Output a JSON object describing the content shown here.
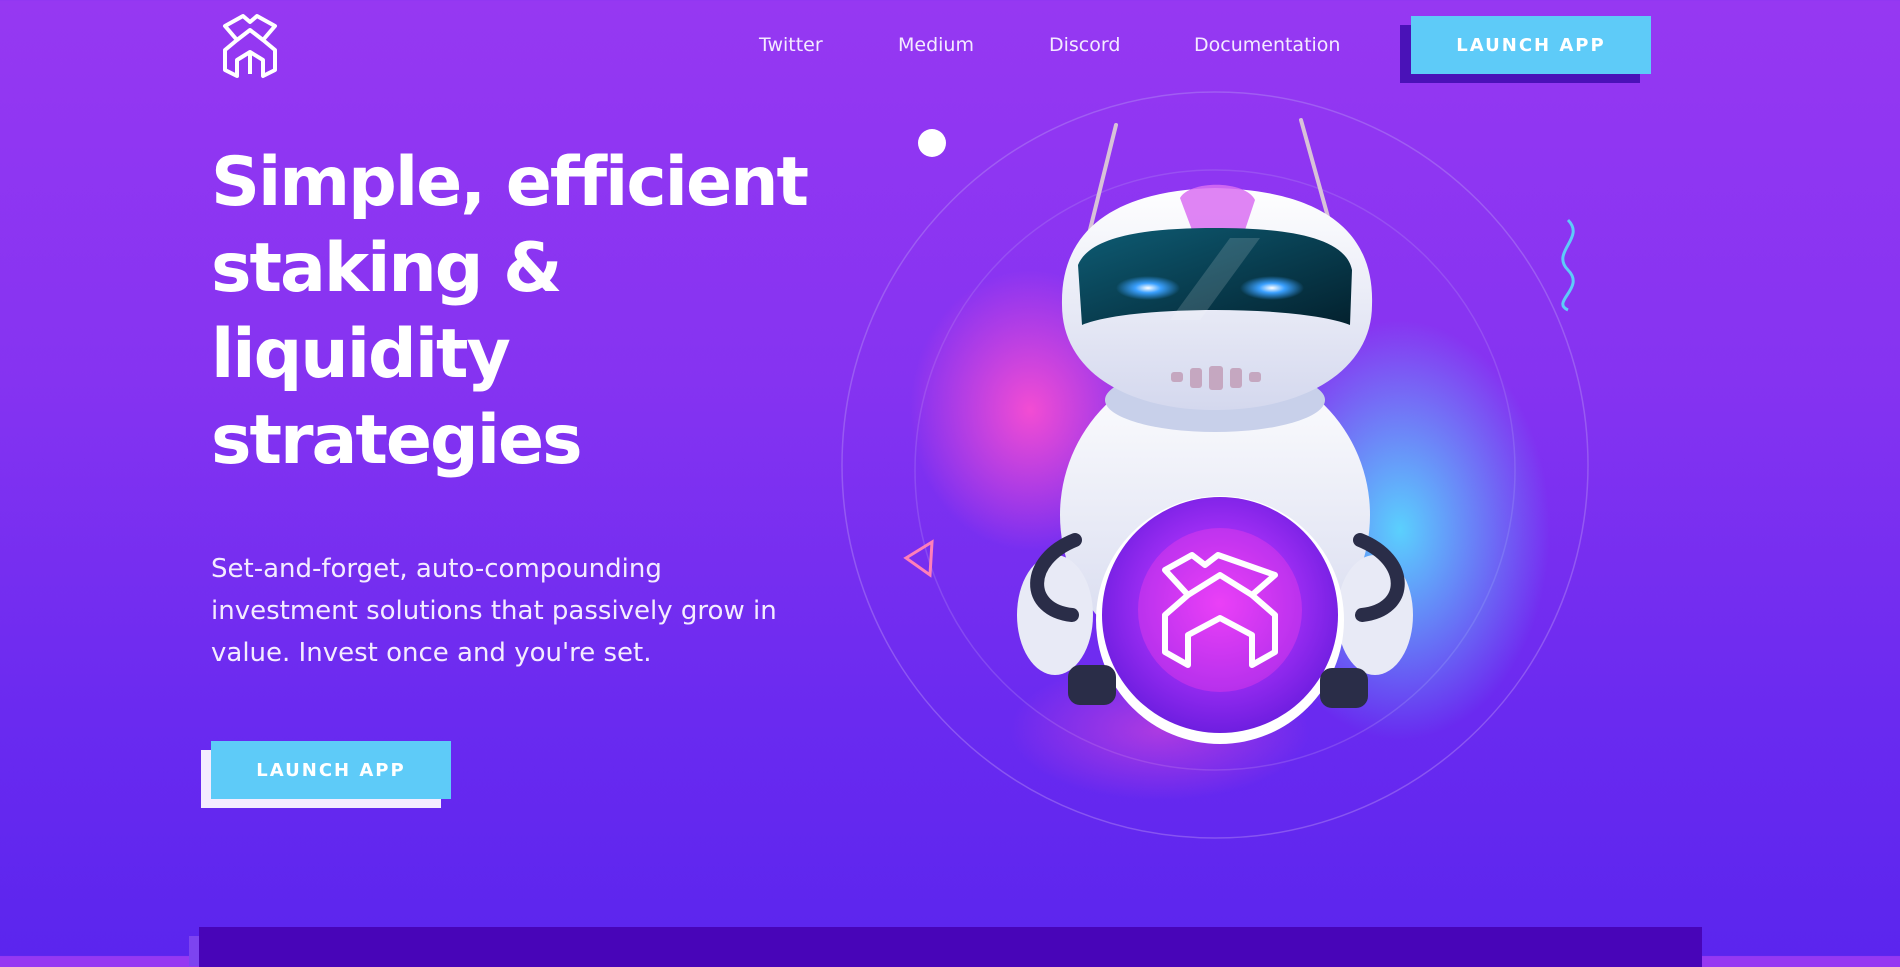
{
  "nav": {
    "links": [
      "Twitter",
      "Medium",
      "Discord",
      "Documentation"
    ],
    "launch_label": "LAUNCH APP"
  },
  "hero": {
    "title": "Simple, efficient staking & liquidity strategies",
    "subtitle": "Set-and-forget, auto-compounding investment solutions that passively grow in value. Invest once and you're set.",
    "cta_label": "LAUNCH APP"
  },
  "colors": {
    "background_top": "#9638f2",
    "background_bottom": "#5b25ee",
    "accent": "#5ecbf8",
    "button_shadow": "#4a12b8",
    "bottom_panel": "#4805b8"
  },
  "icons": {
    "brand": "brand-logo-icon"
  }
}
